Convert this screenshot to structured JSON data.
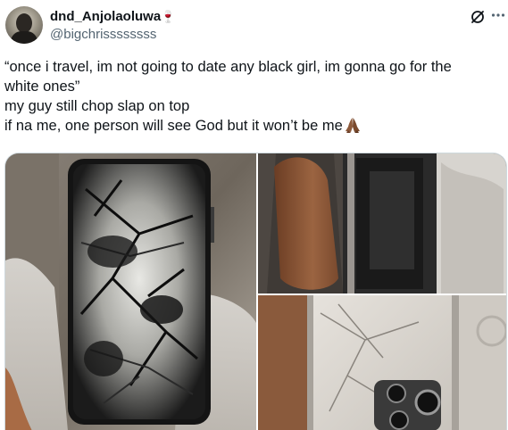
{
  "tweet": {
    "author": {
      "display_name": "dnd_Anjolaoluwa",
      "display_emoji": "🍷",
      "handle": "@bigchrissssssss"
    },
    "lines": [
      "“once i travel, im not going to date any black girl, im gonna go for the",
      "white ones”",
      "my guy still chop slap on top",
      "if na me, one person will see God but it won’t be me"
    ],
    "trailing_icon": "folded-hands-emoji",
    "media": [
      {
        "name": "shattered-phone-front-photo"
      },
      {
        "name": "phone-side-frame-photo"
      },
      {
        "name": "cracked-phone-back-photo"
      }
    ]
  },
  "icons": {
    "grok": "grok-icon",
    "more": "more-options-icon"
  },
  "colors": {
    "text": "#0f1419",
    "secondary": "#536471",
    "border": "#cfd9de"
  }
}
